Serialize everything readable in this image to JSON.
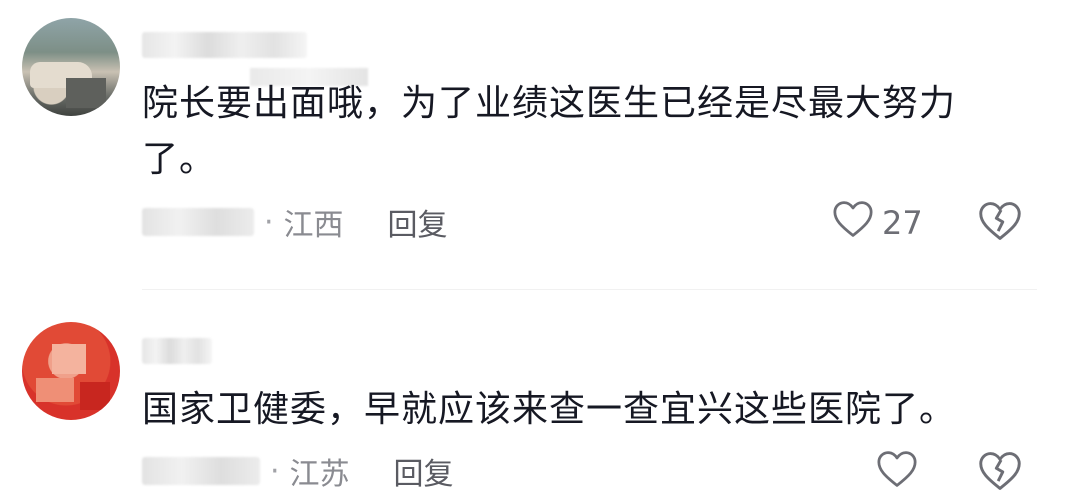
{
  "comments": [
    {
      "text": "院长要出面哦，为了业绩这医生已经是尽最大努力了。",
      "location": "江西",
      "reply_label": "回复",
      "like_count": "27",
      "like_icon": "heart-outline-icon",
      "dislike_icon": "broken-heart-icon"
    },
    {
      "text": "国家卫健委，早就应该来查一查宜兴这些医院了。",
      "location": "江苏",
      "reply_label": "回复",
      "like_count": "",
      "like_icon": "heart-outline-icon",
      "dislike_icon": "broken-heart-icon"
    }
  ],
  "meta_separator": "·",
  "colors": {
    "text_primary": "#161823",
    "text_secondary": "#8a8b91",
    "icon": "#6d6e75"
  }
}
